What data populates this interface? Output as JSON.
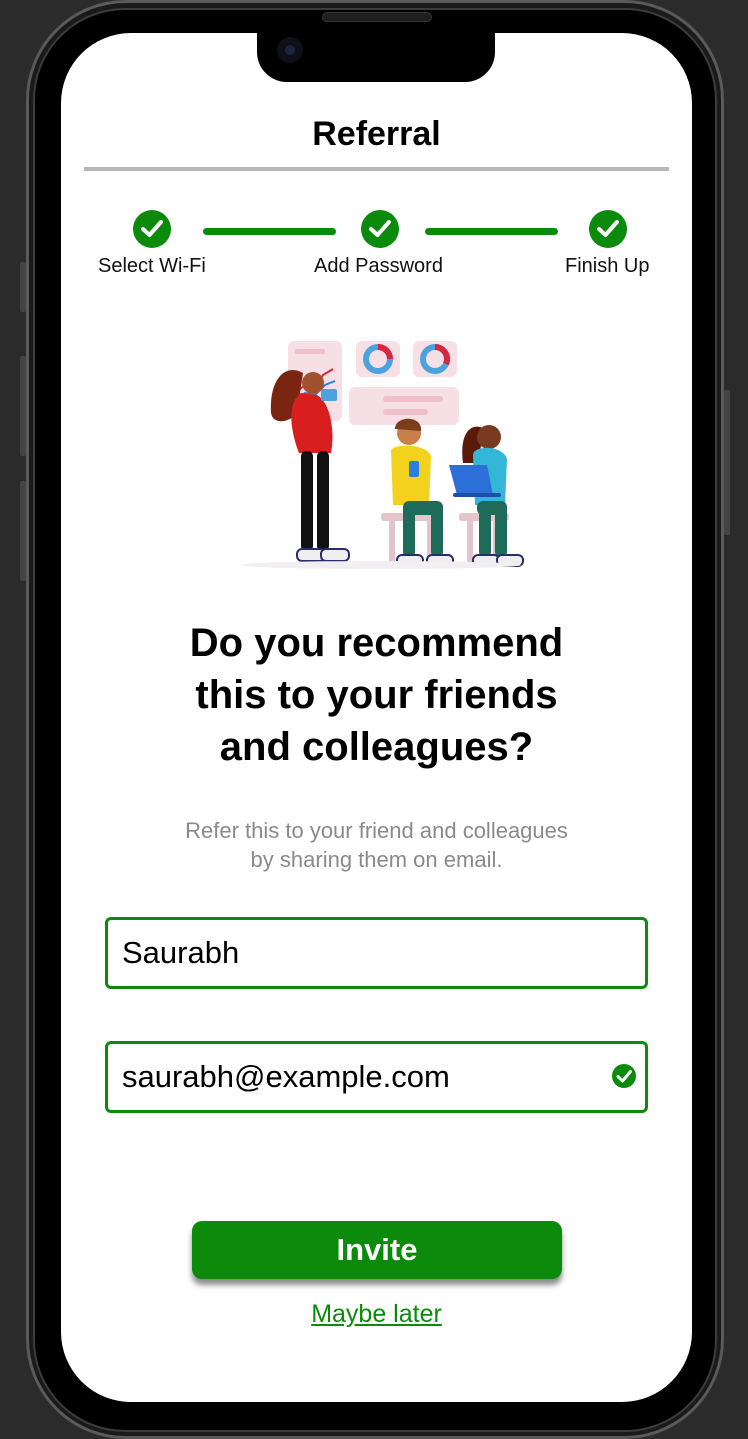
{
  "header": {
    "title": "Referral"
  },
  "steps": [
    {
      "label": "Select Wi-Fi",
      "done": true
    },
    {
      "label": "Add Password",
      "done": true
    },
    {
      "label": "Finish Up",
      "done": true
    }
  ],
  "main": {
    "heading_lines": [
      "Do you recommend",
      "this to your friends",
      "and colleagues?"
    ],
    "subtitle_lines": [
      "Refer this to your friend and colleagues",
      "by sharing them on email."
    ]
  },
  "form": {
    "name_value": "Saurabh",
    "email_value": "saurabh@example.com",
    "email_valid_icon": "check-circle-icon"
  },
  "actions": {
    "invite_label": "Invite",
    "later_label": "Maybe later"
  },
  "colors": {
    "accent": "#0b8a0b",
    "divider": "#b7b7b7",
    "subtitle": "#8a8a8a"
  }
}
